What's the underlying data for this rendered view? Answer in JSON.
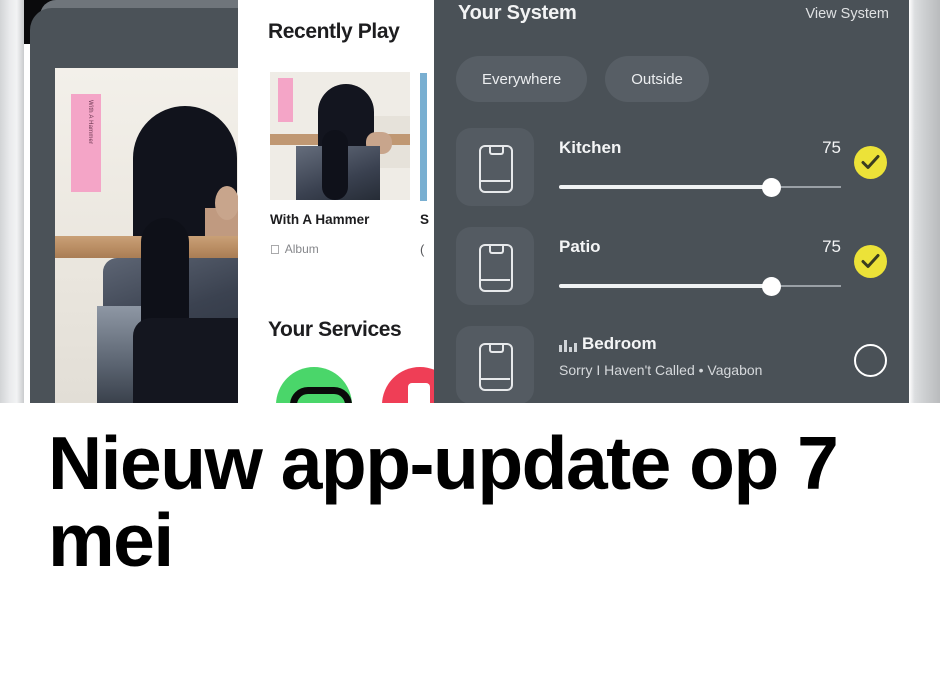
{
  "screenshot": {
    "left_panel": {
      "album_art_label": "With A Hammer album artwork",
      "pink_label_text": "With A Hammer"
    },
    "middle_panel": {
      "recently_played_title": "Recently Play",
      "item1": {
        "title": "With A Hammer",
        "source_icon": "apple-icon",
        "source": "Album"
      },
      "item2": {
        "title": "S",
        "source": "("
      },
      "services_title": "Your Services",
      "services": [
        {
          "name": "spotify",
          "color": "#4ad66a"
        },
        {
          "name": "music",
          "color": "#ef3e56"
        }
      ]
    },
    "system_panel": {
      "title": "Your System",
      "view_system": "View System",
      "filters": [
        {
          "label": "Everywhere"
        },
        {
          "label": "Outside"
        }
      ],
      "rooms": [
        {
          "name": "Kitchen",
          "volume": "75",
          "volume_pct": 75,
          "selected": true,
          "icon": "speaker-icon"
        },
        {
          "name": "Patio",
          "volume": "75",
          "volume_pct": 75,
          "selected": true,
          "icon": "speaker-icon"
        },
        {
          "name": "Bedroom",
          "now_playing": "Sorry I Haven't Called • Vagabon",
          "selected": false,
          "icon": "speaker-icon",
          "playing_icon": "equalizer-icon"
        }
      ]
    }
  },
  "caption": {
    "headline": "Nieuw app-update op 7 mei"
  },
  "colors": {
    "panel_bg": "#4a5157",
    "accent_yellow": "#ece238",
    "spotify_green": "#4ad66a",
    "music_red": "#ef3e56"
  }
}
